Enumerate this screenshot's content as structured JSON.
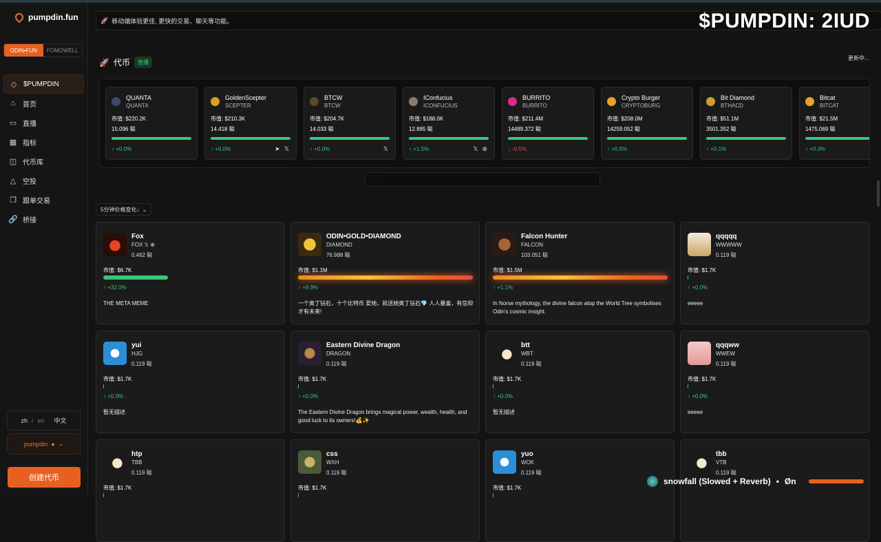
{
  "app": {
    "name": "pumpdin.fun"
  },
  "switcher": {
    "tabs": [
      "ODIN•FUN",
      "FOMOWELL"
    ],
    "active": 0
  },
  "sidebar": {
    "items": [
      {
        "label": "$PUMPDIN",
        "icon": "diamond-icon",
        "active": true
      },
      {
        "label": "首页",
        "icon": "home-icon"
      },
      {
        "label": "直播",
        "icon": "video-icon"
      },
      {
        "label": "指标",
        "icon": "chart-icon"
      },
      {
        "label": "代币库",
        "icon": "vault-icon"
      },
      {
        "label": "空投",
        "icon": "warning-icon"
      },
      {
        "label": "跟单交易",
        "icon": "copy-icon"
      },
      {
        "label": "桥接",
        "icon": "link-icon"
      }
    ],
    "lang": {
      "zh": "zh",
      "sep": "/",
      "en": "en",
      "current": "中文"
    },
    "user": {
      "name": "pumpdin"
    },
    "create_label": "创建代币"
  },
  "banner": {
    "text": "移动端体验更佳, 更快的交易、聊天等功能。"
  },
  "overlay_text": "$PUMPDIN: 2IUD",
  "tokens_section": {
    "title": "代币",
    "badge": "直播",
    "status": "更新中..."
  },
  "tickers": [
    {
      "name": "QUANTA",
      "symbol": "QUANTA",
      "mcap": "市值: $220.2K",
      "sub": "15.096 聪",
      "change": "↑ +0.0%",
      "dir": "up",
      "progress": 1.0,
      "color": "#3b4a6b",
      "social": []
    },
    {
      "name": "GoldenScepter",
      "symbol": "SCEPTER",
      "mcap": "市值: $210.3K",
      "sub": "14.418 聪",
      "change": "↑ +0.0%",
      "dir": "up",
      "progress": 1.0,
      "color": "#d6a21f",
      "social": [
        "telegram-icon",
        "x-icon"
      ]
    },
    {
      "name": "BTCW",
      "symbol": "BTCW",
      "mcap": "市值: $204.7K",
      "sub": "14.033 聪",
      "change": "↑ +0.0%",
      "dir": "up",
      "progress": 1.0,
      "color": "#5a4a2a",
      "social": [
        "x-icon"
      ]
    },
    {
      "name": "IConfucius",
      "symbol": "ICONFUCIUS",
      "mcap": "市值: $188.0K",
      "sub": "12.885 聪",
      "change": "↑ +1.5%",
      "dir": "up",
      "progress": 1.0,
      "color": "#8a7a6a",
      "social": [
        "x-icon",
        "globe-icon"
      ]
    },
    {
      "name": "BURRITO",
      "symbol": "BURRITO",
      "mcap": "市值: $211.4M",
      "sub": "14489.372 聪",
      "change": "↓ -0.5%",
      "dir": "down",
      "progress": 1.0,
      "color": "#d62d8a",
      "social": []
    },
    {
      "name": "Crypto Burger",
      "symbol": "CRYPTOBURG",
      "mcap": "市值: $208.0M",
      "sub": "14259.052 聪",
      "change": "↑ +0.5%",
      "dir": "up",
      "progress": 1.0,
      "color": "#e8a12a",
      "social": []
    },
    {
      "name": "Bit Diamond",
      "symbol": "BTHACD",
      "mcap": "市值: $51.1M",
      "sub": "3501.352 聪",
      "change": "↑ +0.1%",
      "dir": "up",
      "progress": 1.0,
      "color": "#c9a02a",
      "social": []
    },
    {
      "name": "Bitcat",
      "symbol": "BITCAT",
      "mcap": "市值: $21.5M",
      "sub": "1475.069 聪",
      "change": "↑ +0.0%",
      "dir": "up",
      "progress": 1.0,
      "color": "#e8a12a",
      "social": []
    }
  ],
  "pager": {
    "text": "·"
  },
  "sort": {
    "label": "5分钟价格变化↓"
  },
  "cards": [
    {
      "name": "Fox",
      "symbol": "FOX 𝕏 ⊕",
      "price": "0.462 聪",
      "mcap": "市值: $6.7K",
      "change": "↑ +32.0%",
      "progress": 0.37,
      "bar": "green",
      "desc": "THE META MEME",
      "avatar": "fox-avatar"
    },
    {
      "name": "ODIN•GOLD•DIAMOND",
      "symbol": "DIAMOND",
      "price": "76.988 聪",
      "mcap": "市值: $1.1M",
      "change": "↑ +8.9%",
      "progress": 1.0,
      "bar": "fire",
      "desc": "一个奥丁钻石，十个比特币 爱她，就送她奥丁钻石💎 人人暴富，有信仰才有未来!",
      "avatar": "diamond-avatar"
    },
    {
      "name": "Falcon Hunter",
      "symbol": "FALCON",
      "price": "103.051 聪",
      "mcap": "市值: $1.5M",
      "change": "↑ +1.1%",
      "progress": 1.0,
      "bar": "fire",
      "desc": "In Norse mythology, the divine falcon atop the World Tree symbolises Odin's cosmic insight.",
      "avatar": "falcon-avatar"
    },
    {
      "name": "qqqqq",
      "symbol": "WWWWW",
      "price": "0.119 聪",
      "mcap": "市值: $1.7K",
      "change": "↑ +0.0%",
      "progress": 0.0,
      "bar": "green",
      "desc": "eeeee",
      "avatar": "scale-avatar"
    },
    {
      "name": "yui",
      "symbol": "HJG",
      "price": "0.119 聪",
      "mcap": "市值: $1.7K",
      "change": "↑ +0.0%",
      "progress": 0.0,
      "bar": "green",
      "desc": "暂无描述",
      "avatar": "doraemon-avatar"
    },
    {
      "name": "Eastern Divine Dragon",
      "symbol": "DRAGON",
      "price": "0.119 聪",
      "mcap": "市值: $1.7K",
      "change": "↑ +0.0%",
      "progress": 0.0,
      "bar": "green",
      "desc": "The Eastern Divine Dragon brings magical power, wealth, health, and good luck to its owners!💰✨",
      "avatar": "dragon-avatar"
    },
    {
      "name": "btt",
      "symbol": "WBT",
      "price": "0.119 聪",
      "mcap": "市值: $1.7K",
      "change": "↑ +0.0%",
      "progress": 0.0,
      "bar": "green",
      "desc": "暂无描述",
      "avatar": "coin100-avatar"
    },
    {
      "name": "qqqww",
      "symbol": "WWEW",
      "price": "0.119 聪",
      "mcap": "市值: $1.7K",
      "change": "↑ +0.0%",
      "progress": 0.0,
      "bar": "green",
      "desc": "eeeee",
      "avatar": "pink-scale-avatar"
    },
    {
      "name": "htp",
      "symbol": "TBB",
      "price": "0.119 聪",
      "mcap": "市值: $1.7K",
      "change": "",
      "progress": 0.0,
      "bar": "green",
      "desc": "",
      "avatar": "coin100-avatar"
    },
    {
      "name": "css",
      "symbol": "WXH",
      "price": "0.119 聪",
      "mcap": "市值: $1.7K",
      "change": "",
      "progress": 0.0,
      "bar": "green",
      "desc": "",
      "avatar": "owl-avatar"
    },
    {
      "name": "yuo",
      "symbol": "WOK",
      "price": "0.119 聪",
      "mcap": "市值: $1.7K",
      "change": "",
      "progress": 0.0,
      "bar": "green",
      "desc": "",
      "avatar": "doraemon-avatar"
    },
    {
      "name": "tbb",
      "symbol": "VTB",
      "price": "0.119 聪",
      "mcap": "",
      "change": "",
      "progress": 0.0,
      "bar": "green",
      "desc": "",
      "avatar": "coin100-avatar"
    }
  ],
  "music": {
    "title": "snowfall (Slowed + Reverb)",
    "dot": "•",
    "artist": "Øn"
  },
  "colors": {
    "accent": "#e8601f",
    "up": "#37c77a",
    "down": "#e84a4a",
    "bg": "#131313"
  }
}
